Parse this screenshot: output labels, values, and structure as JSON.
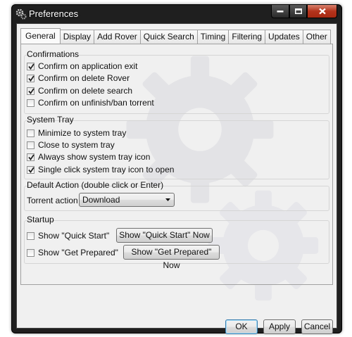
{
  "window": {
    "title": "Preferences"
  },
  "tabs": [
    {
      "label": "General",
      "active": true
    },
    {
      "label": "Display",
      "active": false
    },
    {
      "label": "Add Rover",
      "active": false
    },
    {
      "label": "Quick Search",
      "active": false
    },
    {
      "label": "Timing",
      "active": false
    },
    {
      "label": "Filtering",
      "active": false
    },
    {
      "label": "Updates",
      "active": false
    },
    {
      "label": "Other",
      "active": false
    }
  ],
  "confirmations": {
    "title": "Confirmations",
    "items": [
      {
        "label": "Confirm on application exit",
        "checked": true
      },
      {
        "label": "Confirm on delete Rover",
        "checked": true
      },
      {
        "label": "Confirm on delete search",
        "checked": true
      },
      {
        "label": "Confirm on unfinish/ban torrent",
        "checked": false
      }
    ]
  },
  "system_tray": {
    "title": "System Tray",
    "items": [
      {
        "label": "Minimize to system tray",
        "checked": false
      },
      {
        "label": "Close to system tray",
        "checked": false
      },
      {
        "label": "Always show system tray icon",
        "checked": true
      },
      {
        "label": "Single click system tray icon to open",
        "checked": true
      }
    ]
  },
  "default_action": {
    "title": "Default Action (double click or Enter)",
    "torrent_action_label": "Torrent action",
    "torrent_action_value": "Download"
  },
  "startup": {
    "title": "Startup",
    "quick_start": {
      "label": "Show \"Quick Start\"",
      "checked": false,
      "button": "Show \"Quick Start\" Now"
    },
    "get_prepared": {
      "label": "Show \"Get Prepared\"",
      "checked": false,
      "button": "Show \"Get Prepared\" Now"
    }
  },
  "footer": {
    "ok": "OK",
    "apply": "Apply",
    "cancel": "Cancel"
  },
  "colors": {
    "titlebar": "#1f1f1f",
    "client": "#f0f0f0",
    "close_button": "#b4331c",
    "default_button_border": "#3c7fb1"
  }
}
